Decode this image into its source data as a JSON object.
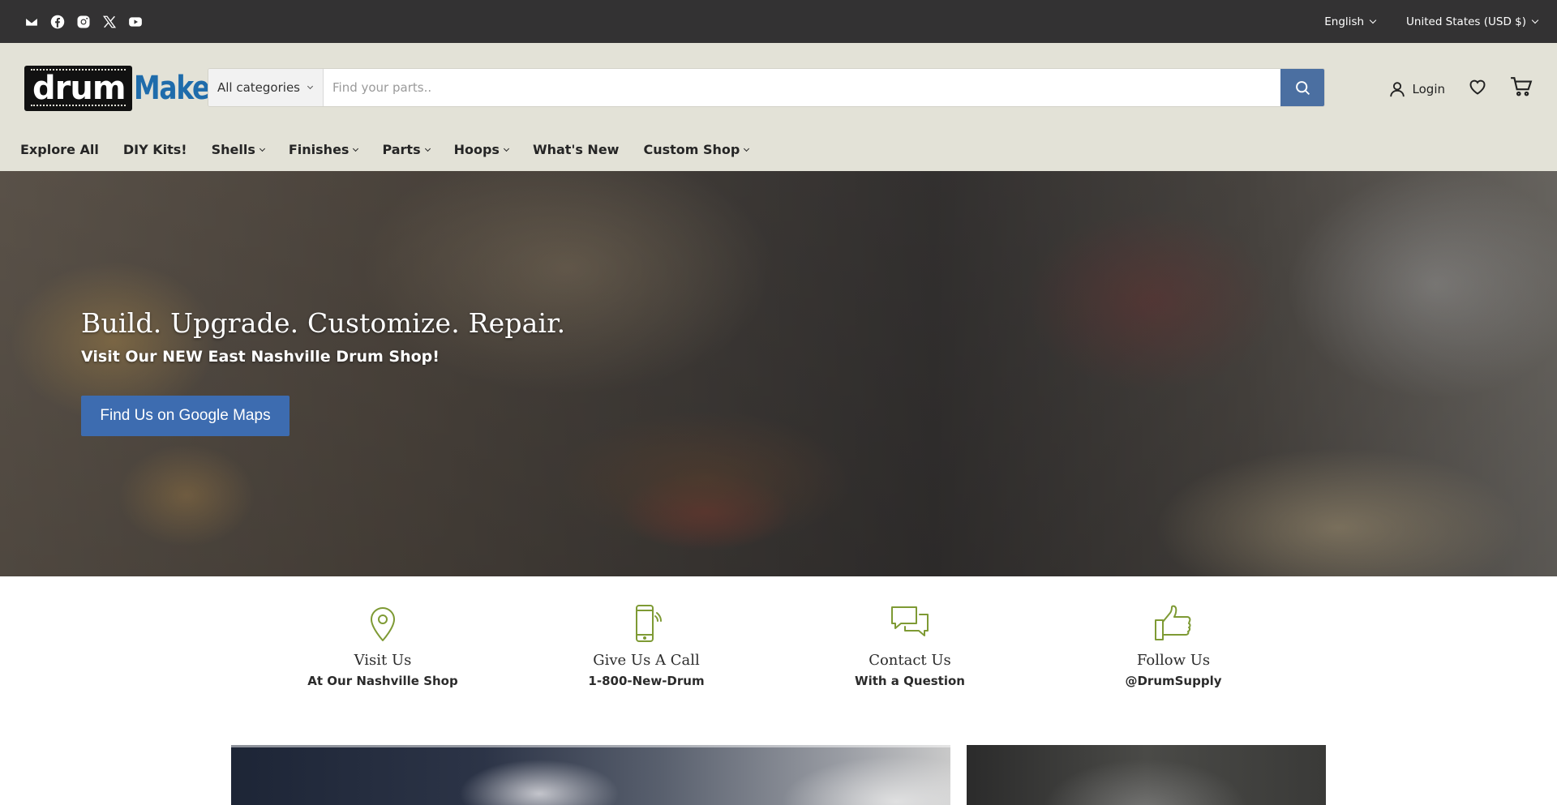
{
  "topbar": {
    "social_icons": [
      "email-icon",
      "facebook-icon",
      "instagram-icon",
      "x-icon",
      "youtube-icon"
    ],
    "language": "English",
    "currency": "United States (USD $)"
  },
  "header": {
    "logo": {
      "part1": "drum",
      "part2": "Maker"
    },
    "search": {
      "category": "All categories",
      "placeholder": "Find your parts.."
    },
    "login_label": "Login"
  },
  "nav": {
    "items": [
      {
        "label": "Explore All",
        "dropdown": false
      },
      {
        "label": "DIY Kits!",
        "dropdown": false
      },
      {
        "label": "Shells",
        "dropdown": true
      },
      {
        "label": "Finishes",
        "dropdown": true
      },
      {
        "label": "Parts",
        "dropdown": true
      },
      {
        "label": "Hoops",
        "dropdown": true
      },
      {
        "label": "What's New",
        "dropdown": false
      },
      {
        "label": "Custom Shop",
        "dropdown": true
      }
    ]
  },
  "hero": {
    "title": "Build. Upgrade. Customize. Repair.",
    "subtitle": "Visit Our NEW East Nashville Drum Shop!",
    "cta": "Find Us on Google Maps"
  },
  "info": [
    {
      "icon": "map-pin-icon",
      "title": "Visit Us",
      "subtitle": "At Our Nashville Shop"
    },
    {
      "icon": "phone-icon",
      "title": "Give Us A Call",
      "subtitle": "1-800-New-Drum"
    },
    {
      "icon": "chat-icon",
      "title": "Contact Us",
      "subtitle": "With a Question"
    },
    {
      "icon": "thumbs-up-icon",
      "title": "Follow Us",
      "subtitle": "@DrumSupply"
    }
  ],
  "colors": {
    "topbar": "#333233",
    "header": "#e3e2d7",
    "search_button": "#4b6fa1",
    "cta": "#3d6cb0",
    "icon_accent": "#7e9a34",
    "logo_blue": "#1f6cab"
  }
}
